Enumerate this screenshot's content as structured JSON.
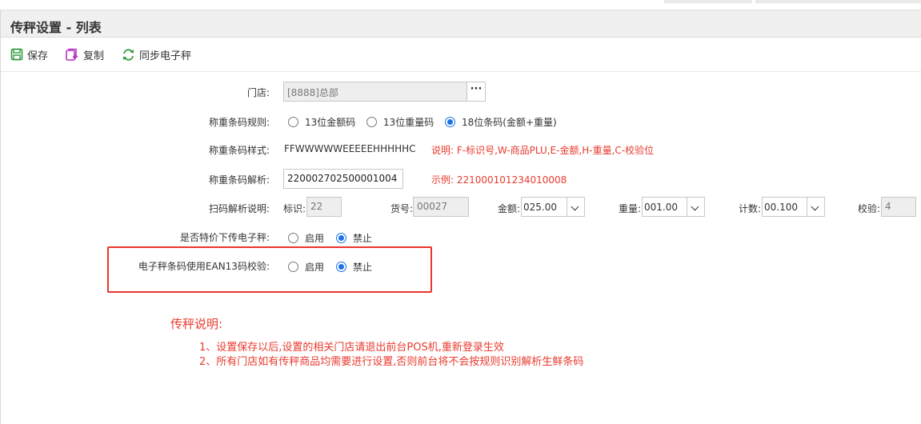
{
  "title": "传秤设置 - 列表",
  "toolbar": {
    "save": "保存",
    "copy": "复制",
    "sync": "同步电子秤"
  },
  "store": {
    "label": "门店:",
    "value": "[8888]总部"
  },
  "rule": {
    "label": "称重条码规则:",
    "options": [
      "13位金额码",
      "13位重量码",
      "18位条码(金额+重量)"
    ],
    "selected": 2
  },
  "style": {
    "label": "称重条码样式:",
    "value": "FFWWWWWEEEEEHHHHHC",
    "note": "说明: F-标识号,W-商品PLU,E-金额,H-重量,C-校验位"
  },
  "parse": {
    "label": "称重条码解析:",
    "value": "220002702500001004",
    "example": "示例: 221000101234010008"
  },
  "scan": {
    "label": "扫码解析说明:",
    "flag_label": "标识:",
    "flag_value": "22",
    "sku_label": "货号:",
    "sku_value": "00027",
    "amount_label": "金额:",
    "amount_value": "025.00",
    "weight_label": "重量:",
    "weight_value": "001.00",
    "count_label": "计数:",
    "count_value": "00.100",
    "check_label": "校验:",
    "check_value": "4"
  },
  "special": {
    "label": "是否特价下传电子秤:",
    "on": "启用",
    "off": "禁止",
    "selected": "off"
  },
  "ean13": {
    "label": "电子秤条码使用EAN13码校验:",
    "on": "启用",
    "off": "禁止",
    "selected": "off"
  },
  "notes": {
    "title": "传秤说明:",
    "line1": "1、设置保存以后,设置的相关门店请退出前台POS机,重新登录生效",
    "line2": "2、所有门店如有传秤商品均需要进行设置,否则前台将不会按规则识别解析生鲜条码"
  },
  "colors": {
    "accent": "#1a73e8",
    "note_red": "#e83a2e",
    "highlight_border": "#e8372b",
    "save_icon": "#2e9a3c",
    "copy_icon": "#b832c4",
    "sync_icon": "#2e9a3c"
  }
}
